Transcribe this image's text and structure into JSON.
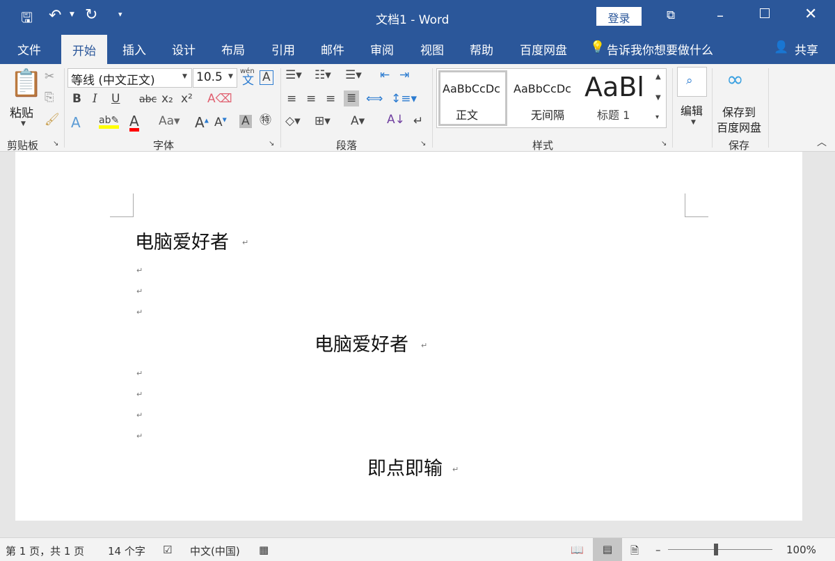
{
  "title": {
    "doc_name": "文档1 - Word",
    "login": "登录"
  },
  "tabs": [
    {
      "label": "文件"
    },
    {
      "label": "开始"
    },
    {
      "label": "插入"
    },
    {
      "label": "设计"
    },
    {
      "label": "布局"
    },
    {
      "label": "引用"
    },
    {
      "label": "邮件"
    },
    {
      "label": "审阅"
    },
    {
      "label": "视图"
    },
    {
      "label": "帮助"
    },
    {
      "label": "百度网盘"
    }
  ],
  "tell_me": "告诉我你想要做什么",
  "share": "共享",
  "ribbon": {
    "clipboard": {
      "paste": "粘贴",
      "group": "剪贴板"
    },
    "font": {
      "name": "等线 (中文正文)",
      "size": "10.5",
      "group": "字体",
      "phonetic": "wén",
      "phonetic_char": "文"
    },
    "paragraph": {
      "group": "段落"
    },
    "styles": {
      "group": "样式",
      "items": [
        {
          "preview": "AaBbCcDc",
          "label": "正文"
        },
        {
          "preview": "AaBbCcDc",
          "label": "无间隔"
        },
        {
          "preview": "AaBl",
          "label": "标题 1"
        }
      ]
    },
    "editing": {
      "label": "编辑"
    },
    "save": {
      "label1": "保存到",
      "label2": "百度网盘",
      "group": "保存"
    }
  },
  "document": {
    "line1": "电脑爱好者",
    "line2": "电脑爱好者",
    "line3": "即点即输",
    "para_mark": "↵"
  },
  "status": {
    "page": "第 1 页，共 1 页",
    "words": "14 个字",
    "lang": "中文(中国)",
    "zoom": "100%"
  },
  "colors": {
    "brand": "#2b579a",
    "highlight": "#ffff00",
    "font_color": "#ff0000"
  }
}
